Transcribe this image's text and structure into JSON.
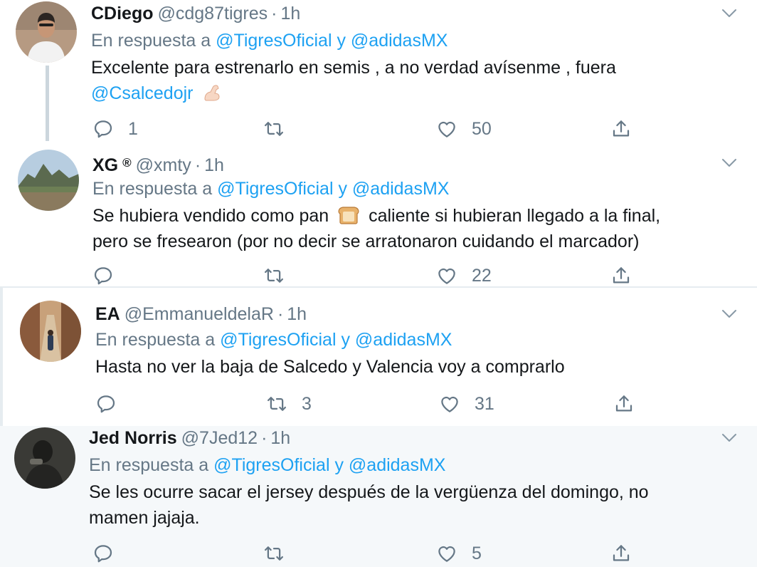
{
  "reply_prefix": "En respuesta a",
  "and_word": "y",
  "colors": {
    "link": "#1da1f2",
    "muted": "#657786",
    "text": "#14171a",
    "highlight_bg": "#f5f8fa"
  },
  "tweets": [
    {
      "name": "CDiego",
      "badge": "",
      "handle": "@cdg87tigres",
      "time": "1h",
      "mention1": "@TigresOficial",
      "mention2": "@adidasMX",
      "text": "Excelente para estrenarlo en semis , a no verdad avísenme , fuera",
      "text2": "@Csalcedojr",
      "emoji": "flexed-biceps",
      "replies": "1",
      "retweets": "",
      "likes": "50"
    },
    {
      "name": "XG",
      "badge": "®",
      "handle": "@xmty",
      "time": "1h",
      "mention1": "@TigresOficial",
      "mention2": "@adidasMX",
      "text_a": "Se hubiera vendido como pan",
      "text_b": "caliente si hubieran llegado a la final,",
      "text_c": "pero se fresearon (por no decir se arratonaron cuidando el marcador)",
      "emoji": "bread",
      "replies": "",
      "retweets": "",
      "likes": "22"
    },
    {
      "name": "EA",
      "badge": "",
      "handle": "@EmmanueldelaR",
      "time": "1h",
      "mention1": "@TigresOficial",
      "mention2": "@adidasMX",
      "text": "Hasta no ver la baja de Salcedo y Valencia voy a comprarlo",
      "replies": "",
      "retweets": "3",
      "likes": "31"
    },
    {
      "name": "Jed Norris",
      "badge": "",
      "handle": "@7Jed12",
      "time": "1h",
      "mention1": "@TigresOficial",
      "mention2": "@adidasMX",
      "text_a": "Se les ocurre sacar el jersey después de la vergüenza del domingo, no",
      "text_b": "mamen jajaja.",
      "replies": "",
      "retweets": "",
      "likes": "5"
    }
  ]
}
